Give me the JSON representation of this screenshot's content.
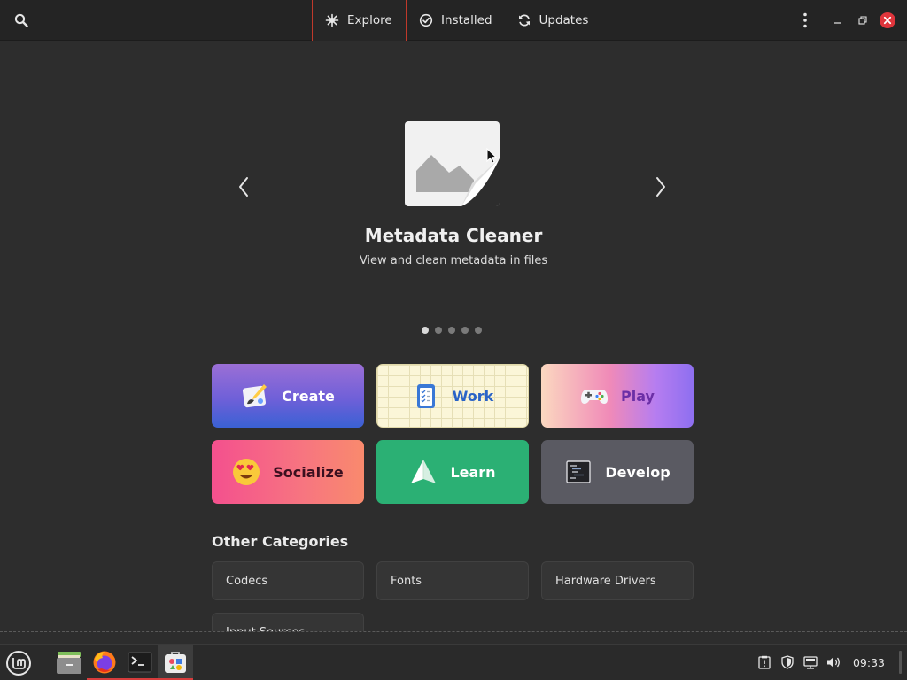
{
  "header": {
    "search_icon": "search-icon",
    "tabs": [
      {
        "label": "Explore",
        "icon": "explore-icon",
        "active": true
      },
      {
        "label": "Installed",
        "icon": "check-circle-icon",
        "active": false
      },
      {
        "label": "Updates",
        "icon": "refresh-icon",
        "active": false
      }
    ],
    "menu_icon": "kebab-menu-icon",
    "window_buttons": [
      "minimize-icon",
      "maximize-icon",
      "close-icon"
    ],
    "close_color": "#e0353c"
  },
  "featured": {
    "title": "Metadata Cleaner",
    "subtitle": "View and clean metadata in files",
    "page": 1,
    "page_count": 5
  },
  "categories": [
    {
      "label": "Create",
      "icon": "palette-icon"
    },
    {
      "label": "Work",
      "icon": "clipboard-checklist-icon"
    },
    {
      "label": "Play",
      "icon": "gamepad-icon"
    },
    {
      "label": "Socialize",
      "icon": "heart-eyes-emoji-icon"
    },
    {
      "label": "Learn",
      "icon": "paper-plane-icon"
    },
    {
      "label": "Develop",
      "icon": "terminal-code-icon"
    }
  ],
  "other_categories": {
    "title": "Other Categories",
    "items": [
      "Codecs",
      "Fonts",
      "Hardware Drivers",
      "Input Sources"
    ]
  },
  "taskbar": {
    "apps": [
      {
        "name": "Files",
        "icon": "folder-icon",
        "running": false
      },
      {
        "name": "Firefox",
        "icon": "firefox-icon",
        "running": true
      },
      {
        "name": "Terminal",
        "icon": "terminal-icon",
        "running": true
      },
      {
        "name": "Software",
        "icon": "software-store-icon",
        "running": true,
        "focused": true
      }
    ],
    "tray_icons": [
      "clipboard-alert-icon",
      "shield-update-icon",
      "network-icon",
      "volume-icon"
    ],
    "clock": "09:33"
  },
  "colors": {
    "accent": "#c0392b",
    "background": "#2d2d2d"
  }
}
